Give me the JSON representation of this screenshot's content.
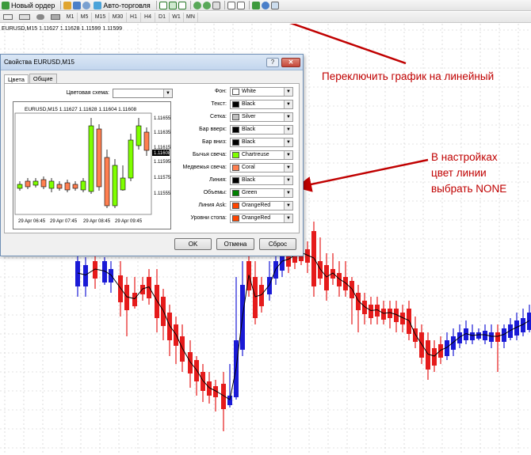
{
  "toolbar": {
    "new_order_label": "Новый ордер",
    "autotrading_label": "Авто-торговля"
  },
  "timeframes": [
    "M1",
    "M5",
    "M15",
    "M30",
    "H1",
    "H4",
    "D1",
    "W1",
    "MN"
  ],
  "chart": {
    "caption": "EURUSD,M15  1.11627 1.11628 1.11599 1.11599"
  },
  "annotations": {
    "line_chart": "Переключить график на линейный",
    "settings_line1": "В настройках",
    "settings_line2": "цвет линии",
    "settings_line3": "выбрать NONE"
  },
  "dialog": {
    "title": "Свойства EURUSD,M15",
    "tabs": [
      "Цвета",
      "Общие"
    ],
    "color_scheme_label": "Цветовая схема:",
    "color_scheme_value": "",
    "preview": {
      "caption": "EURUSD,M15  1.11627 1.11628 1.11604 1.11608",
      "prices": [
        "1.11655",
        "1.11635",
        "1.11615",
        "1.11608",
        "1.11595",
        "1.11575",
        "1.11555"
      ],
      "times": [
        "29 Apr 06:45",
        "29 Apr 07:45",
        "29 Apr 08:45",
        "29 Apr 09:45"
      ]
    },
    "properties": [
      {
        "label": "Фон:",
        "value": "White",
        "color": "#ffffff"
      },
      {
        "label": "Текст:",
        "value": "Black",
        "color": "#000000"
      },
      {
        "label": "Сетка:",
        "value": "Silver",
        "color": "#c0c0c0"
      },
      {
        "label": "Бар вверх:",
        "value": "Black",
        "color": "#000000"
      },
      {
        "label": "Бар вниз:",
        "value": "Black",
        "color": "#000000"
      },
      {
        "label": "Бычья свеча:",
        "value": "Chartreuse",
        "color": "#7fff00"
      },
      {
        "label": "Медвежья свеча:",
        "value": "Coral",
        "color": "#ff7f50"
      },
      {
        "label": "Линия:",
        "value": "Black",
        "color": "#000000"
      },
      {
        "label": "Объемы:",
        "value": "Green",
        "color": "#008000"
      },
      {
        "label": "Линия Ask:",
        "value": "OrangeRed",
        "color": "#ff4500"
      },
      {
        "label": "Уровни стопа:",
        "value": "OrangeRed",
        "color": "#ff4500"
      }
    ],
    "ok_label": "OK",
    "cancel_label": "Отмена",
    "reset_label": "Сброс"
  },
  "colors": {
    "bull": "#1a1ad6",
    "bear": "#e51b1b",
    "annotation": "#c00000",
    "grid": "#c8c8c8"
  }
}
